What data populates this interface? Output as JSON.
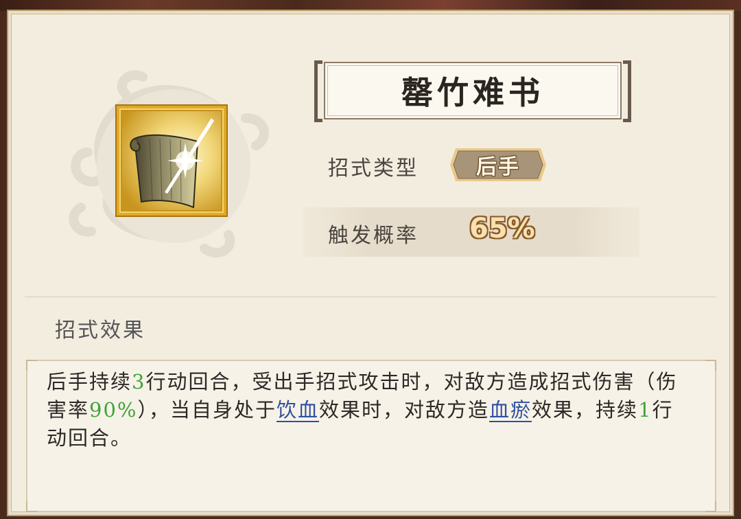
{
  "skill": {
    "title": "罄竹难书",
    "type_label": "招式类型",
    "type_value": "后手",
    "rate_label": "触发概率",
    "rate_value": "65%",
    "icon": "banner-scroll-slash-icon"
  },
  "effect": {
    "section_label": "招式效果",
    "segments": {
      "s1": "后手持续",
      "n1": "3",
      "s2": "行动回合，受出手招式攻击时，对敌方造成招式伤害（伤害率",
      "n2": "90%",
      "s3": "），当自身处于",
      "l1": "饮血",
      "s4": "效果时，对敌方造",
      "l2": "血瘀",
      "s5": "效果，持续",
      "n3": "1",
      "s6": "行动回合。"
    }
  },
  "colors": {
    "panel_bg": "#f3ede0",
    "number_green": "#3fa33a",
    "link_blue": "#2f4fa0",
    "icon_gold": "#e0a92a"
  }
}
